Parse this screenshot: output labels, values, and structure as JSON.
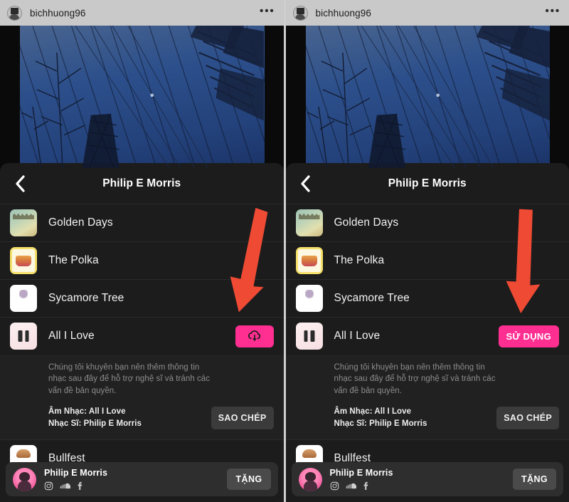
{
  "layout": {
    "panels": 2,
    "divider_color": "#cfcfcf",
    "frame_color": "#000000"
  },
  "colors": {
    "accent_pink": "#ff2f92",
    "arrow_red": "#ef4a34",
    "sheet_bg": "#1c1c1c",
    "expanded_bg": "#212121",
    "secondary_button": "#3b3b3b",
    "gift_button": "#4a4a4a",
    "muted_text": "#8d8d8d"
  },
  "instagram_header": {
    "username": "bichhuong96",
    "avatar_icon": "profile-avatar-icon",
    "more_icon": "more-options-dots-icon",
    "more_glyph": "•••"
  },
  "sheet": {
    "back_icon": "back-chevron-icon",
    "title": "Philip E Morris"
  },
  "tracks": [
    {
      "id": "golden-days",
      "title": "Golden Days",
      "art": "golden-days-album-art"
    },
    {
      "id": "the-polka",
      "title": "The Polka",
      "art": "the-polka-album-art"
    },
    {
      "id": "sycamore-tree",
      "title": "Sycamore Tree",
      "art": "sycamore-tree-album-art"
    },
    {
      "id": "all-i-love",
      "title": "All I Love",
      "art": "all-i-love-album-art"
    },
    {
      "id": "bullfest",
      "title": "Bullfest",
      "art": "bullfest-album-art"
    }
  ],
  "selected_track": {
    "title": "All I Love",
    "advice": "Chúng tôi khuyên bạn nên thêm thông tin nhạc sau đây để hỗ trợ nghệ sĩ và tránh các vấn đề bản quyền.",
    "music_line": "Âm Nhạc: All I Love",
    "artist_line": "Nhạc Sĩ: Philip E Morris",
    "copy_label": "SAO CHÉP"
  },
  "left_panel": {
    "action_button": {
      "label": "",
      "icon": "cloud-download-icon",
      "state": "download"
    }
  },
  "right_panel": {
    "action_button": {
      "label": "SỬ DỤNG",
      "icon": "",
      "state": "use"
    }
  },
  "artist_bar": {
    "name": "Philip E Morris",
    "avatar_icon": "artist-avatar-icon",
    "gift_label": "TẶNG",
    "socials": [
      {
        "name": "instagram-icon"
      },
      {
        "name": "soundcloud-icon"
      },
      {
        "name": "facebook-icon"
      }
    ]
  },
  "annotations": [
    {
      "name": "arrow-left",
      "points_to": "download-button",
      "color": "#ef4a34",
      "rotation_deg": 14
    },
    {
      "name": "arrow-right",
      "points_to": "use-button",
      "color": "#ef4a34",
      "rotation_deg": 0
    }
  ]
}
